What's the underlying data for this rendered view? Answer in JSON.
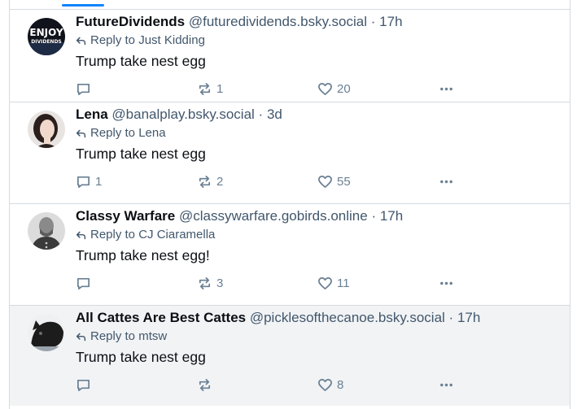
{
  "posts": [
    {
      "name": "FutureDividends",
      "handle": "@futuredividends.bsky.social",
      "time": "17h",
      "reply_prefix": "Reply to",
      "reply_to": "Just Kidding",
      "text": "Trump take nest egg",
      "replies": "",
      "reposts": "1",
      "likes": "20",
      "avatar_icon": "enjoy-dividends-logo",
      "avatar_text": [
        "ENJOY",
        "DIVIDENDS"
      ]
    },
    {
      "name": "Lena",
      "handle": "@banalplay.bsky.social",
      "time": "3d",
      "reply_prefix": "Reply to",
      "reply_to": "Lena",
      "text": "Trump take nest egg",
      "replies": "1",
      "reposts": "2",
      "likes": "55",
      "avatar_icon": "portrait-photo"
    },
    {
      "name": "Classy Warfare",
      "handle": "@classywarfare.gobirds.online",
      "time": "17h",
      "reply_prefix": "Reply to",
      "reply_to": "CJ Ciaramella",
      "text": "Trump take nest egg!",
      "replies": "",
      "reposts": "3",
      "likes": "11",
      "avatar_icon": "general-portrait"
    },
    {
      "name": "All Cattes Are Best Cattes",
      "handle": "@picklesofthecanoe.bsky.social",
      "time": "17h",
      "reply_prefix": "Reply to",
      "reply_to": "mtsw",
      "text": "Trump take nest egg",
      "replies": "",
      "reposts": "",
      "likes": "8",
      "avatar_icon": "cat-photo"
    }
  ],
  "separator": "·",
  "colors": {
    "accent": "#1083fe",
    "muted": "#42576c",
    "icon": "#6a7f93",
    "border": "#d4dbe2",
    "highlight": "#f1f3f5"
  }
}
